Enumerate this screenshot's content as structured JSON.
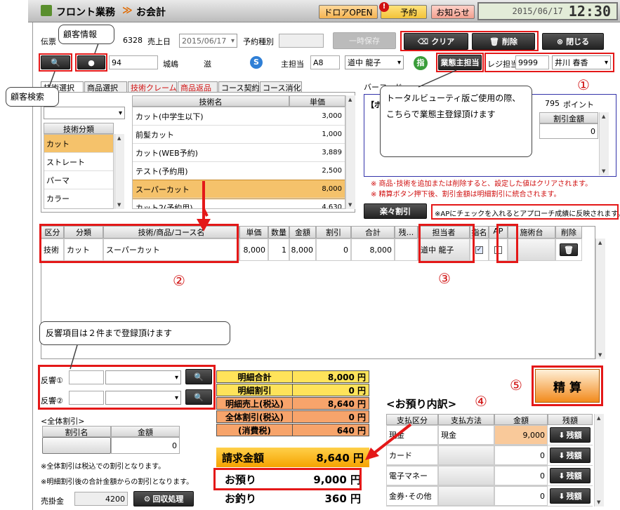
{
  "titlebar": {
    "app": "フロント業務",
    "sep": "≫",
    "screen": "お会計",
    "drawer": "ドロアOPEN",
    "reserve": "予約",
    "notice": "お知らせ",
    "datetime": "2015/06/17",
    "time": "12:30"
  },
  "header": {
    "slip_label": "伝票",
    "slip_no": "6328",
    "sales_date_label": "売上日",
    "sales_date": "2015/06/17",
    "reserve_type_label": "予約種別",
    "reserve_type": "",
    "hold_btn": "一時保存",
    "clear_btn": "クリア",
    "delete_btn": "削除",
    "close_btn": "閉じる"
  },
  "customer": {
    "id": "94",
    "last": "城嶋",
    "first": "滋",
    "s_badge": "S",
    "main_staff_label": "主担当",
    "main_staff_code": "A8",
    "main_staff_name": "道中 龍子",
    "shimei": "指",
    "industry_btn": "業態主担当",
    "register_label": "レジ担当",
    "register_code": "9999",
    "register_name": "井川 春香"
  },
  "tabs": [
    "技術選択",
    "商品選択",
    "技術クレーム",
    "商品返品",
    "コース契約",
    "コース消化"
  ],
  "category": {
    "header": "技術分類",
    "items": [
      "カット",
      "ストレート",
      "パーマ",
      "カラー"
    ]
  },
  "tech_list": {
    "col_name": "技術名",
    "col_price": "単価",
    "items": [
      {
        "name": "カット(中学生以下)",
        "price": "3,000"
      },
      {
        "name": "前髪カット",
        "price": "1,000"
      },
      {
        "name": "カット(WEB予約)",
        "price": "3,889"
      },
      {
        "name": "テスト(予約用)",
        "price": "2,500"
      },
      {
        "name": "スーパーカット",
        "price": "8,000"
      },
      {
        "name": "カット2(予約用)",
        "price": "4,630"
      }
    ]
  },
  "right_panel": {
    "barcode_label": "バーコード",
    "bracket": "【ポ",
    "points": "795",
    "points_label": "ポイント",
    "discount_col": "割引金額",
    "discount_val": "0",
    "note1": "※ 商品･技術を追加または削除すると、設定した値はクリアされます。",
    "note2": "※ 精算ボタン押下後、割引金額は明細割引に統合されます。",
    "rakuraku_btn": "楽々割引",
    "ap_note": "※APにチェックを入れるとアプローチ成績に反映されます。"
  },
  "detail": {
    "headers": [
      "区分",
      "分類",
      "技術/商品/コース名",
      "単価",
      "数量",
      "金額",
      "割引",
      "合計",
      "残...",
      "担当者",
      "指名",
      "AP",
      "施術台",
      "削除"
    ],
    "row": {
      "kubun": "技術",
      "bunrui": "カット",
      "name": "スーパーカット",
      "price": "8,000",
      "qty": "1",
      "amount": "8,000",
      "discount": "0",
      "total": "8,000",
      "staff": "道中 龍子"
    }
  },
  "hankyo": {
    "label1": "反響①",
    "label2": "反響②"
  },
  "all_discount": {
    "title": "<全体割引>",
    "col_name": "割引名",
    "col_amount": "金額",
    "amount": "0",
    "note1": "※全体割引は税込での割引となります。",
    "note2": "※明細割引後の合計金額からの割引となります。"
  },
  "receivable": {
    "label": "売掛金",
    "value": "4200",
    "btn": "回収処理"
  },
  "summary": [
    {
      "k": "明細合計",
      "v": "8,000 円"
    },
    {
      "k": "明細割引",
      "v": "0 円"
    },
    {
      "k": "明細売上(税込)",
      "v": "8,640 円"
    },
    {
      "k": "全体割引(税込)",
      "v": "0 円"
    },
    {
      "k": "(消費税)",
      "v": "640 円"
    }
  ],
  "totals": {
    "bill_label": "請求金額",
    "bill": "8,640 円",
    "deposit_label": "お預り",
    "deposit": "9,000 円",
    "change_label": "お釣り",
    "change": "360 円"
  },
  "payment": {
    "title": "<お預り内訳>",
    "headers": [
      "支払区分",
      "支払方法",
      "金額",
      "残額"
    ],
    "rows": [
      {
        "kubun": "現金",
        "method": "現金",
        "amount": "9,000"
      },
      {
        "kubun": "カード",
        "method": "",
        "amount": "0"
      },
      {
        "kubun": "電子マネー",
        "method": "",
        "amount": "0"
      },
      {
        "kubun": "金券･その他",
        "method": "",
        "amount": "0"
      }
    ],
    "zangaku_btn": "残額"
  },
  "settle_btn": "精 算",
  "annotations": {
    "customer_info": "顧客情報",
    "customer_search": "顧客検索",
    "total_beauty": "トータルビューティ版ご使用の際、こちらで業態主登録頂けます",
    "hankyo_note": "反響項目は２件まで登録頂けます",
    "c1": "①",
    "c2": "②",
    "c3": "③",
    "c4": "④",
    "c5": "⑤"
  },
  "colors": {
    "accent_orange": "#f5c26b",
    "settle_orange": "#f28a1c",
    "sum_yellow": "#ffe35a",
    "sum_orange": "#f7a46b",
    "red": "#e41818"
  }
}
